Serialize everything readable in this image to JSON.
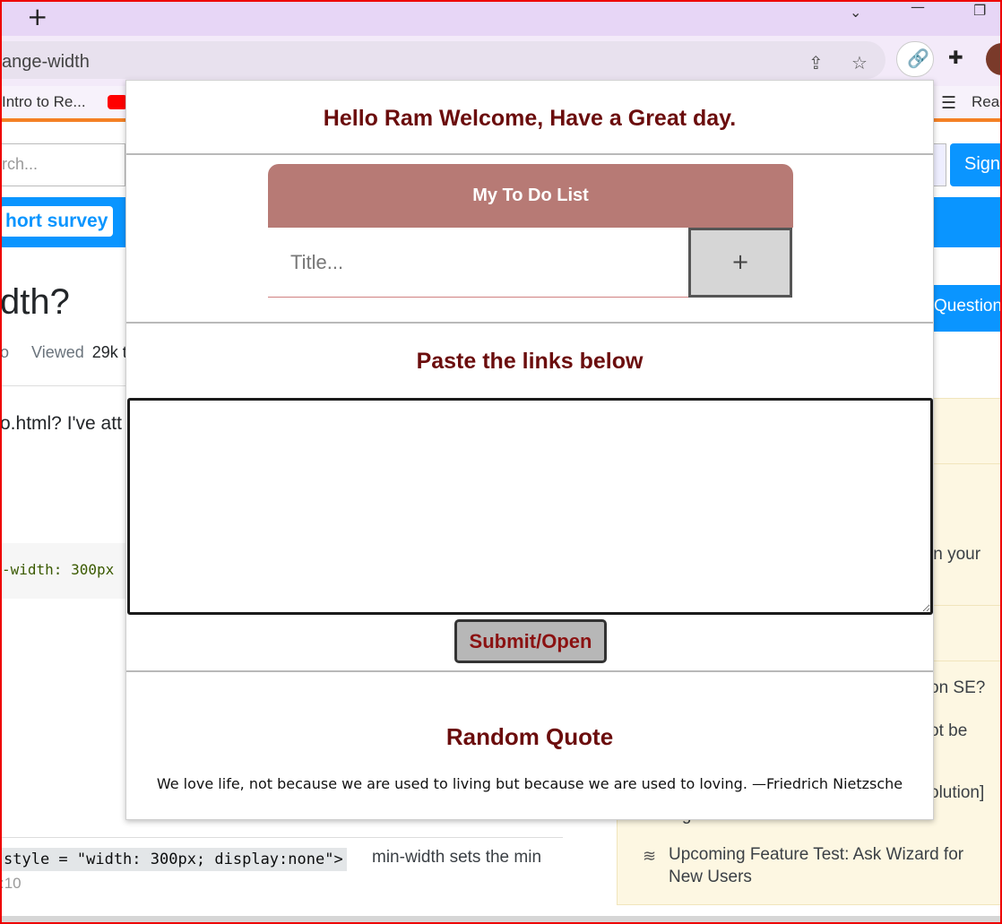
{
  "browser": {
    "new_tab_icon": "plus-icon",
    "url_fragment": "ange-width",
    "bookmarks": {
      "intro": "Intro to Re...",
      "reading_list": "Read"
    }
  },
  "background_page": {
    "search_placeholder": "rch...",
    "survey_text": "hort survey",
    "sign_button": "Sign",
    "ask_button": "Question",
    "question_title": "dth?",
    "meta_prefix": "o",
    "meta_viewed_label": "Viewed",
    "meta_viewed_value": "29k t",
    "body_text": "o.html? I've att",
    "code_snippet": "-width: 300px",
    "sidebar_texts": {
      "in_your": "in your",
      "on_se": "on SE?",
      "ot_be": "ot be",
      "olution": "olution]",
      "tag": "tag?",
      "upcoming_line1": "Upcoming Feature Test: Ask Wizard for",
      "upcoming_line2": "New Users"
    },
    "bottom_code": "style = \"width: 300px; display:none\">",
    "bottom_text": "min-width sets the min",
    "bottom_small": ":10"
  },
  "popup": {
    "greeting": "Hello Ram Welcome, Have a Great day.",
    "todo": {
      "header": "My To Do List",
      "input_placeholder": "Title...",
      "add_label": "+"
    },
    "links": {
      "title": "Paste the links below",
      "textarea_value": "",
      "submit_label": "Submit/Open"
    },
    "quote": {
      "title": "Random Quote",
      "text": "We love life, not because we are used to living but because we are used to loving. —Friedrich Nietzsche"
    }
  },
  "colors": {
    "heading": "#6b0d0d",
    "todo_header_bg": "#b77a75",
    "accent_blue": "#0a95ff"
  }
}
